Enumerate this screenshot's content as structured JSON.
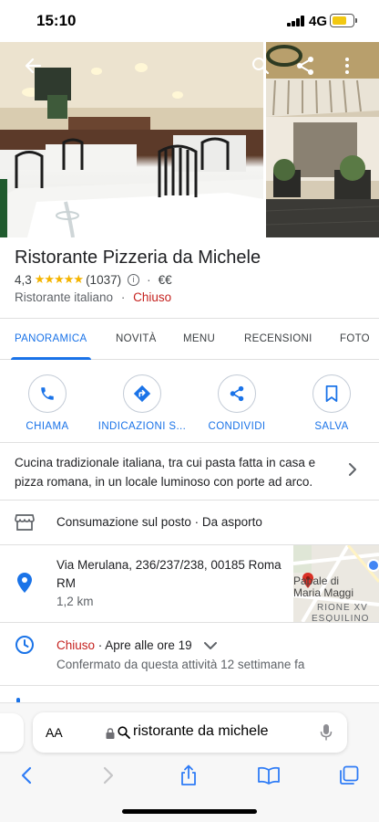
{
  "status_bar": {
    "time": "15:10",
    "network": "4G",
    "battery_fraction": 0.7
  },
  "header": {
    "back_icon": "arrow-left-icon",
    "search_icon": "search-icon",
    "share_icon": "share-icon",
    "more_icon": "more-vert-icon"
  },
  "place": {
    "name": "Ristorante Pizzeria da Michele",
    "rating": "4,3",
    "stars": "★★★★★",
    "reviews": "(1037)",
    "price": "€€",
    "category": "Ristorante italiano",
    "status": "Chiuso"
  },
  "tabs": [
    {
      "label": "PANORAMICA",
      "active": true
    },
    {
      "label": "NOVITÀ"
    },
    {
      "label": "MENU"
    },
    {
      "label": "RECENSIONI"
    },
    {
      "label": "FOTO"
    }
  ],
  "actions": [
    {
      "label": "CHIAMA",
      "icon": "phone-icon"
    },
    {
      "label": "INDICAZIONI S...",
      "icon": "directions-icon"
    },
    {
      "label": "CONDIVIDI",
      "icon": "share-icon"
    },
    {
      "label": "SALVA",
      "icon": "bookmark-icon"
    }
  ],
  "description": "Cucina tradizionale italiana, tra cui pasta fatta in casa e pizza romana, in un locale luminoso con porte ad arco.",
  "service": "Consumazione sul posto · Da asporto",
  "address": {
    "line1": "Via Merulana, 236/237/238, 00185 Roma",
    "line2": "RM",
    "distance": "1,2 km"
  },
  "map": {
    "label1": "Papale di",
    "label2": "Maria Maggi",
    "label3": "RIONE XV",
    "label4": "ESQUILINO"
  },
  "hours": {
    "status": "Chiuso",
    "opens": "· Apre alle ore 19",
    "confirmed": "Confermato da questa attività 12 settimane fa"
  },
  "browser": {
    "text_size_label": "AA",
    "url": "ristorante da michele"
  },
  "colors": {
    "accent": "#1a73e8",
    "closed": "#c5221f",
    "star": "#f4b400"
  }
}
